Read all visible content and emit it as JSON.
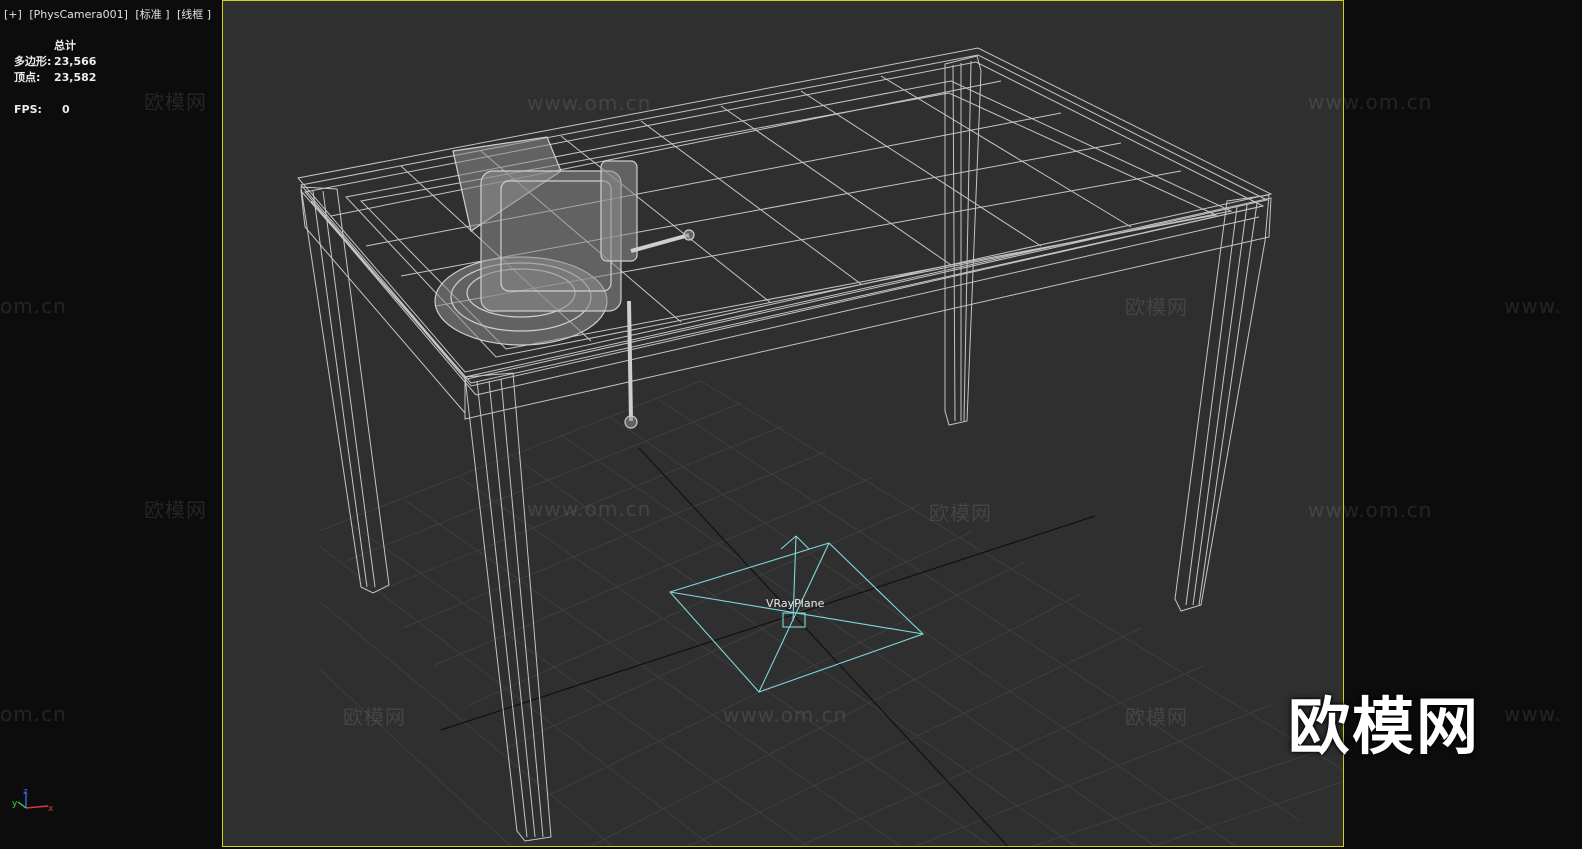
{
  "viewport": {
    "label_plus": "[+]",
    "label_camera": "[PhysCamera001]",
    "label_shading": "[标准 ]",
    "label_mode": "[线框 ]"
  },
  "stats": {
    "header": "总计",
    "polys_label": "多边形:",
    "polys_value": "23,566",
    "verts_label": "顶点:",
    "verts_value": "23,582",
    "fps_label": "FPS:",
    "fps_value": "0"
  },
  "scene": {
    "object_label": "VRayPlane",
    "wireframe_color": "#d8d8d8",
    "plane_color": "#7fd8dc",
    "frame_color": "#cfcf1e"
  },
  "watermarks": {
    "cn": "欧模网",
    "url": "www.om.cn",
    "url_short": "om.cn",
    "url_prefix": "www.",
    "big": "欧模网"
  },
  "gizmo": {
    "x": "x",
    "y": "y",
    "z": "z"
  }
}
